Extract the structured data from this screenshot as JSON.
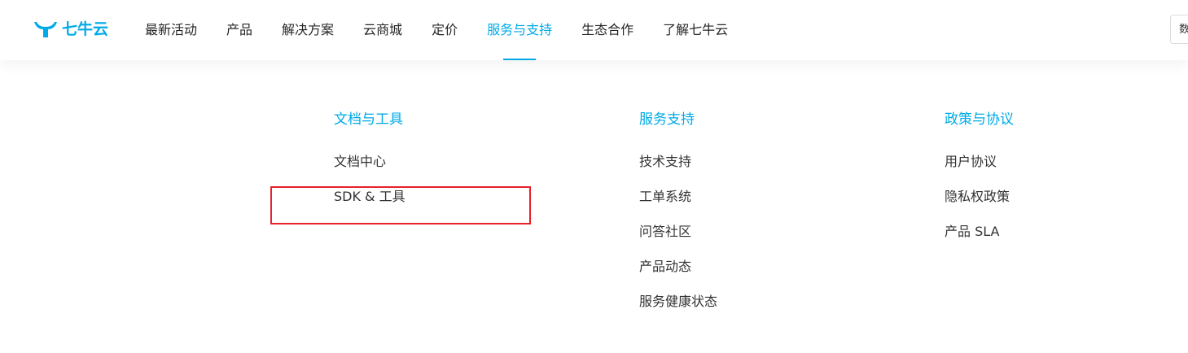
{
  "brand": {
    "name": "七牛云",
    "color": "#00aae7"
  },
  "nav": {
    "items": [
      {
        "label": "最新活动",
        "active": false
      },
      {
        "label": "产品",
        "active": false
      },
      {
        "label": "解决方案",
        "active": false
      },
      {
        "label": "云商城",
        "active": false
      },
      {
        "label": "定价",
        "active": false
      },
      {
        "label": "服务与支持",
        "active": true
      },
      {
        "label": "生态合作",
        "active": false
      },
      {
        "label": "了解七牛云",
        "active": false
      }
    ],
    "right_partial": "数"
  },
  "dropdown": {
    "columns": [
      {
        "title": "文档与工具",
        "links": [
          "文档中心",
          "SDK & 工具"
        ]
      },
      {
        "title": "服务支持",
        "links": [
          "技术支持",
          "工单系统",
          "问答社区",
          "产品动态",
          "服务健康状态"
        ]
      },
      {
        "title": "政策与协议",
        "links": [
          "用户协议",
          "隐私权政策",
          "产品 SLA"
        ]
      }
    ]
  },
  "annotation": {
    "color": "#e8202a"
  }
}
